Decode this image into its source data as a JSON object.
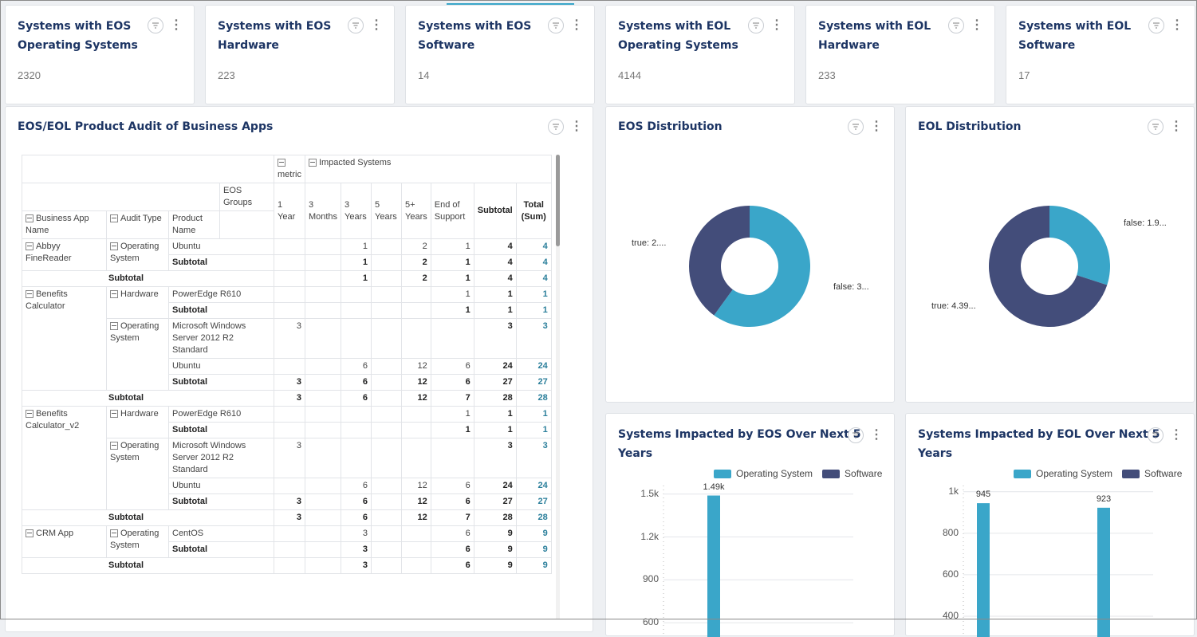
{
  "colors": {
    "teal": "#3aa6c9",
    "navy": "#434d7a",
    "title": "#1d3564"
  },
  "kpis": [
    {
      "title_l1": "Systems with EOS",
      "title_l2": "Operating Systems",
      "value": "2320"
    },
    {
      "title_l1": "Systems with EOS",
      "title_l2": "Hardware",
      "value": "223"
    },
    {
      "title_l1": "Systems with EOS",
      "title_l2": "Software",
      "value": "14"
    },
    {
      "title_l1": "Systems with EOL",
      "title_l2": "Operating Systems",
      "value": "4144"
    },
    {
      "title_l1": "Systems with EOL",
      "title_l2": "Hardware",
      "value": "233"
    },
    {
      "title_l1": "Systems with EOL",
      "title_l2": "Software",
      "value": "17"
    }
  ],
  "pivot": {
    "title": "EOS/EOL Product Audit of Business Apps",
    "metric": "metric",
    "impacted": "Impacted Systems",
    "eos_groups": "EOS Groups",
    "row_headers": [
      "Business App Name",
      "Audit Type",
      "Product Name"
    ],
    "col_headers": [
      "1 Year",
      "3 Months",
      "3 Years",
      "5 Years",
      "5+ Years",
      "End of Support",
      "Subtotal",
      "Total (Sum)"
    ],
    "subtotal": "Subtotal",
    "apps": [
      {
        "name": "Abbyy FineReader",
        "groups": [
          {
            "type": "Operating System",
            "rows": [
              [
                "Ubuntu",
                "",
                "",
                "1",
                "",
                "2",
                "1",
                "4",
                "4"
              ]
            ],
            "sub": [
              "",
              "",
              "1",
              "",
              "2",
              "1",
              "4",
              "4"
            ]
          }
        ],
        "sub": [
          "",
          "",
          "1",
          "",
          "2",
          "1",
          "4",
          "4"
        ]
      },
      {
        "name": "Benefits Calculator",
        "groups": [
          {
            "type": "Hardware",
            "rows": [
              [
                "PowerEdge R610",
                "",
                "",
                "",
                "",
                "",
                "1",
                "1",
                "1"
              ]
            ],
            "sub": [
              "",
              "",
              "",
              "",
              "",
              "1",
              "1",
              "1"
            ]
          },
          {
            "type": "Operating System",
            "rows": [
              [
                "Microsoft Windows Server 2012 R2 Standard",
                "3",
                "",
                "",
                "",
                "",
                "",
                "3",
                "3"
              ],
              [
                "Ubuntu",
                "",
                "",
                "6",
                "",
                "12",
                "6",
                "24",
                "24"
              ]
            ],
            "sub": [
              "3",
              "",
              "6",
              "",
              "12",
              "6",
              "27",
              "27"
            ]
          }
        ],
        "sub": [
          "3",
          "",
          "6",
          "",
          "12",
          "7",
          "28",
          "28"
        ]
      },
      {
        "name": "Benefits Calculator_v2",
        "groups": [
          {
            "type": "Hardware",
            "rows": [
              [
                "PowerEdge R610",
                "",
                "",
                "",
                "",
                "",
                "1",
                "1",
                "1"
              ]
            ],
            "sub": [
              "",
              "",
              "",
              "",
              "",
              "1",
              "1",
              "1"
            ]
          },
          {
            "type": "Operating System",
            "rows": [
              [
                "Microsoft Windows Server 2012 R2 Standard",
                "3",
                "",
                "",
                "",
                "",
                "",
                "3",
                "3"
              ],
              [
                "Ubuntu",
                "",
                "",
                "6",
                "",
                "12",
                "6",
                "24",
                "24"
              ]
            ],
            "sub": [
              "3",
              "",
              "6",
              "",
              "12",
              "6",
              "27",
              "27"
            ]
          }
        ],
        "sub": [
          "3",
          "",
          "6",
          "",
          "12",
          "7",
          "28",
          "28"
        ]
      },
      {
        "name": "CRM App",
        "groups": [
          {
            "type": "Operating System",
            "rows": [
              [
                "CentOS",
                "",
                "",
                "3",
                "",
                "",
                "6",
                "9",
                "9"
              ]
            ],
            "sub": [
              "",
              "",
              "3",
              "",
              "",
              "6",
              "9",
              "9"
            ]
          }
        ],
        "sub": [
          "",
          "",
          "3",
          "",
          "",
          "6",
          "9",
          "9"
        ]
      }
    ]
  },
  "chart_data": [
    {
      "type": "pie",
      "title": "EOS Distribution",
      "labels": [
        "true: 2....",
        "false: 3..."
      ],
      "values": [
        40,
        60
      ],
      "colors": [
        "#434d7a",
        "#3aa6c9"
      ],
      "hole": true
    },
    {
      "type": "pie",
      "title": "EOL Distribution",
      "labels": [
        "false: 1.9...",
        "true: 4.39..."
      ],
      "values": [
        30,
        70
      ],
      "colors": [
        "#3aa6c9",
        "#434d7a"
      ],
      "hole": true
    },
    {
      "type": "bar",
      "title": "Systems Impacted by EOS Over Next 5 Years",
      "title_l1": "Systems Impacted by EOS Over Next 5",
      "title_l2": "Years",
      "series": [
        {
          "name": "Operating System",
          "values": [
            1490
          ]
        },
        {
          "name": "Software",
          "values": []
        }
      ],
      "bar_labels": [
        "1.49k"
      ],
      "yticks": [
        "1.5k",
        "1.2k",
        "900",
        "600"
      ],
      "ytick_values": [
        1500,
        1200,
        900,
        600
      ],
      "ylim": [
        500,
        1560
      ]
    },
    {
      "type": "bar",
      "title": "Systems Impacted by EOL Over Next 5 Years",
      "title_l1": "Systems Impacted by EOL Over Next 5",
      "title_l2": "Years",
      "series": [
        {
          "name": "Operating System",
          "values": [
            945,
            923
          ]
        },
        {
          "name": "Software",
          "values": []
        }
      ],
      "bar_labels": [
        "945",
        "923"
      ],
      "yticks": [
        "1k",
        "800",
        "600",
        "400"
      ],
      "ytick_values": [
        1000,
        800,
        600,
        400
      ],
      "ylim": [
        300,
        1030
      ]
    }
  ]
}
